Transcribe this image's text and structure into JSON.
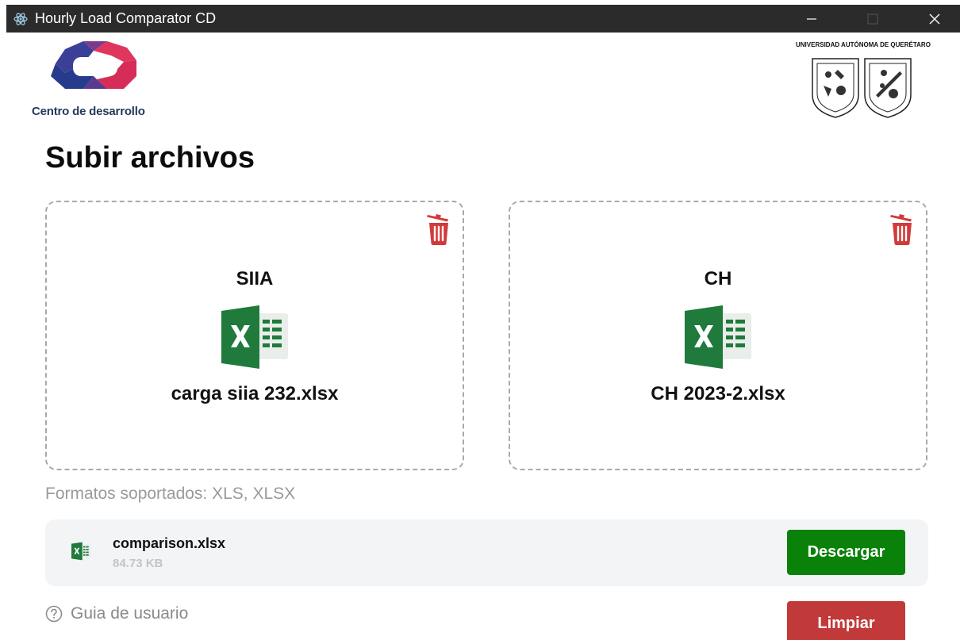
{
  "window": {
    "title": "Hourly Load Comparator CD",
    "controls": {
      "minimize": "minimize-icon",
      "maximize": "maximize-icon",
      "close": "close-icon"
    }
  },
  "header": {
    "brand_text": "Centro de desarrollo",
    "university_text": "UNIVERSIDAD AUTÓNOMA DE QUERÉTARO"
  },
  "page": {
    "title": "Subir archivos"
  },
  "uploads": [
    {
      "label": "SIIA",
      "file_name": "carga siia 232.xlsx",
      "icon": "excel-icon",
      "delete_icon": "trash-icon"
    },
    {
      "label": "CH",
      "file_name": "CH 2023-2.xlsx",
      "icon": "excel-icon",
      "delete_icon": "trash-icon"
    }
  ],
  "formats_text": "Formatos soportados: XLS, XLSX",
  "result": {
    "file_name": "comparison.xlsx",
    "file_size": "84.73 KB",
    "download_label": "Descargar"
  },
  "footer": {
    "guide_label": "Guia de usuario",
    "clear_label": "Limpiar"
  },
  "colors": {
    "titlebar": "#2b2b2b",
    "download": "#0a820a",
    "clear": "#c23939",
    "trash": "#d23b3b",
    "excel_green": "#1f7a3c"
  }
}
